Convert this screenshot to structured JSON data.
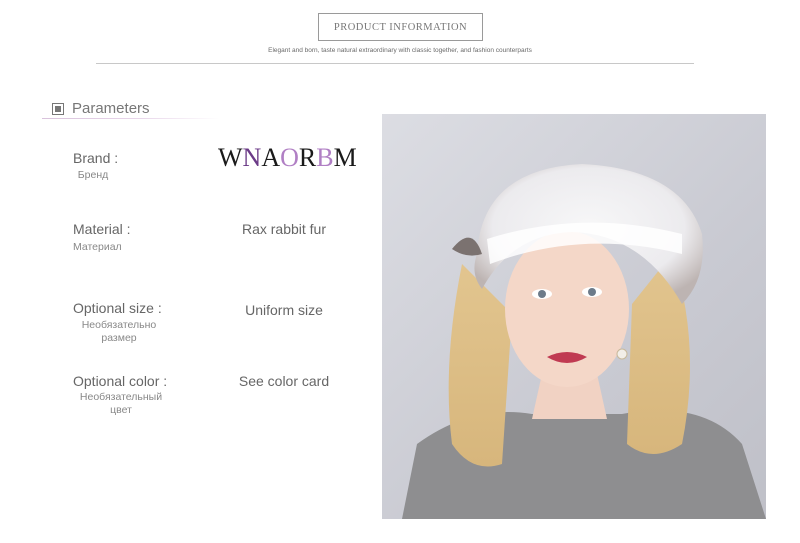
{
  "header": {
    "title": "PRODUCT INFORMATION",
    "tagline": "Elegant and born, taste natural extraordinary with classic together, and fashion counterparts"
  },
  "parameters": {
    "heading": "Parameters",
    "brand": {
      "label": "Brand :",
      "sublabel": "Бренд",
      "logo": {
        "letters": [
          "W",
          "N",
          "A",
          "O",
          "R",
          "B",
          "M"
        ],
        "colors": [
          "#1a1a1a",
          "#6b3a87",
          "#1a1a1a",
          "#b07fc4",
          "#1a1a1a",
          "#b07fc4",
          "#1a1a1a"
        ]
      }
    },
    "material": {
      "label": "Material :",
      "sublabel": "Материал",
      "value": "Rax rabbit fur"
    },
    "size": {
      "label": "Optional size :",
      "sublabel": "Необязательно размер",
      "value": "Uniform size"
    },
    "color": {
      "label": "Optional color :",
      "sublabel": "Необязательный цвет",
      "value": "See color card"
    }
  }
}
